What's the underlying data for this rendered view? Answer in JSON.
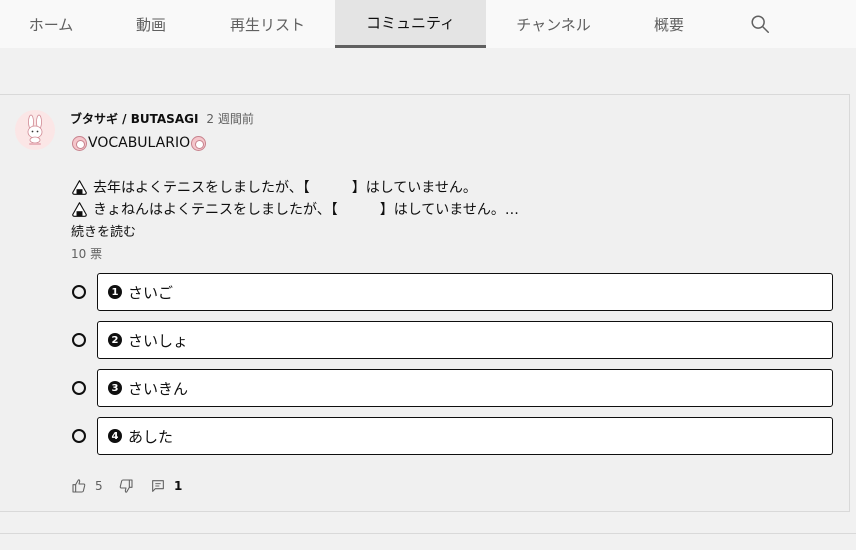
{
  "tabs": [
    {
      "label": "ホーム",
      "selected": false
    },
    {
      "label": "動画",
      "selected": false
    },
    {
      "label": "再生リスト",
      "selected": false
    },
    {
      "label": "コミュニティ",
      "selected": true
    },
    {
      "label": "チャンネル",
      "selected": false
    },
    {
      "label": "概要",
      "selected": false
    }
  ],
  "post": {
    "author": "ブタサギ / BUTASAGI",
    "time": "2 週間前",
    "title": "VOCABULARIO",
    "line1": "去年はよくテニスをしましたが、【　　　】はしていません。",
    "line2": "きょねんはよくテニスをしましたが、【　　　】はしていません。…",
    "read_more": "続きを読む",
    "votes": "10 票",
    "options": [
      {
        "num": "1",
        "label": "さいご"
      },
      {
        "num": "2",
        "label": "さいしょ"
      },
      {
        "num": "3",
        "label": "さいきん"
      },
      {
        "num": "4",
        "label": "あした"
      }
    ],
    "likes": "5",
    "comments": "1"
  },
  "icons": {
    "search": "search-icon",
    "like": "thumbs-up-icon",
    "dislike": "thumbs-down-icon",
    "comment": "comment-icon",
    "bullet": "onigiri-icon",
    "decor": "pink-circle-icon"
  },
  "colors": {
    "background": "#f1f1f1",
    "tab_selected_bg": "#e4e4e4",
    "text_secondary": "#606060",
    "avatar_bg": "#fbe6e6"
  }
}
